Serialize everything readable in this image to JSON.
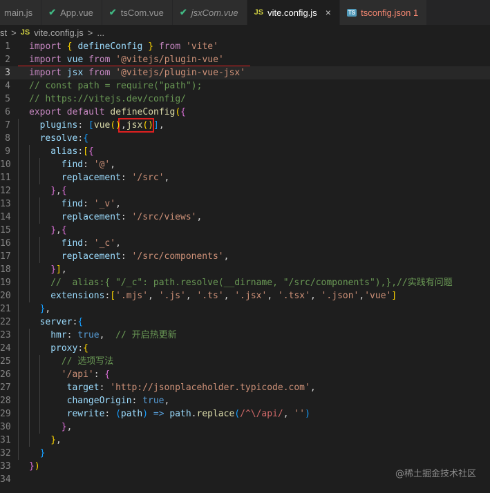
{
  "tabs": [
    {
      "label": "main.js",
      "icon": "js-icon",
      "active": false,
      "italic": false
    },
    {
      "label": "App.vue",
      "icon": "vue-icon",
      "active": false,
      "italic": false
    },
    {
      "label": "tsCom.vue",
      "icon": "vue-icon",
      "active": false,
      "italic": false
    },
    {
      "label": "jsxCom.vue",
      "icon": "vue-icon",
      "active": false,
      "italic": true
    },
    {
      "label": "vite.config.js",
      "icon": "js-icon",
      "active": true,
      "italic": false
    },
    {
      "label": "tsconfig.json 1",
      "icon": "ts-icon",
      "active": false,
      "italic": false
    }
  ],
  "breadcrumb": {
    "prefix": "st",
    "file": "vite.config.js",
    "tail": "..."
  },
  "icons": {
    "js": "JS",
    "ts": "TS",
    "vue": "V",
    "close": "×"
  },
  "colors": {
    "keyword": "#c586c0",
    "string": "#ce9178",
    "comment": "#6a9955",
    "highlight_box": "#e02020"
  },
  "current_line": 3,
  "lines": [
    {
      "n": "1",
      "indent": 0,
      "tokens": [
        [
          "kw",
          "import"
        ],
        [
          "p",
          " "
        ],
        [
          "b1",
          "{"
        ],
        [
          "p",
          " "
        ],
        [
          "var",
          "defineConfig"
        ],
        [
          "p",
          " "
        ],
        [
          "b1",
          "}"
        ],
        [
          "p",
          " "
        ],
        [
          "kw",
          "from"
        ],
        [
          "p",
          " "
        ],
        [
          "str",
          "'vite'"
        ]
      ]
    },
    {
      "n": "2",
      "indent": 0,
      "tokens": [
        [
          "kw",
          "import"
        ],
        [
          "p",
          " "
        ],
        [
          "var",
          "vue"
        ],
        [
          "p",
          " "
        ],
        [
          "kw",
          "from"
        ],
        [
          "p",
          " "
        ],
        [
          "str",
          "'@vitejs/plugin-vue'"
        ]
      ]
    },
    {
      "n": "3",
      "indent": 0,
      "tokens": [
        [
          "kw",
          "import"
        ],
        [
          "p",
          " "
        ],
        [
          "var",
          "jsx"
        ],
        [
          "p",
          " "
        ],
        [
          "kw",
          "from"
        ],
        [
          "p",
          " "
        ],
        [
          "str",
          "'@vitejs/plugin-vue-jsx'"
        ]
      ]
    },
    {
      "n": "4",
      "indent": 0,
      "tokens": [
        [
          "cmt",
          "// const path = require(\"path\");"
        ]
      ]
    },
    {
      "n": "5",
      "indent": 0,
      "tokens": [
        [
          "cmt",
          "// https://vitejs.dev/config/"
        ]
      ]
    },
    {
      "n": "6",
      "indent": 0,
      "tokens": [
        [
          "kw",
          "export"
        ],
        [
          "p",
          " "
        ],
        [
          "kw",
          "default"
        ],
        [
          "p",
          " "
        ],
        [
          "fn",
          "defineConfig"
        ],
        [
          "b1",
          "("
        ],
        [
          "b2",
          "{"
        ]
      ]
    },
    {
      "n": "7",
      "indent": 1,
      "tokens": [
        [
          "var",
          "plugins"
        ],
        [
          "p",
          ": "
        ],
        [
          "b3",
          "["
        ],
        [
          "fn",
          "vue"
        ],
        [
          "b1",
          "()"
        ],
        [
          "p",
          ","
        ],
        [
          "fn",
          "jsx"
        ],
        [
          "b1",
          "()"
        ],
        [
          "b3",
          "]"
        ],
        [
          "p",
          ","
        ]
      ]
    },
    {
      "n": "8",
      "indent": 1,
      "tokens": [
        [
          "var",
          "resolve"
        ],
        [
          "p",
          ":"
        ],
        [
          "b3",
          "{"
        ]
      ]
    },
    {
      "n": "9",
      "indent": 2,
      "tokens": [
        [
          "var",
          "alias"
        ],
        [
          "p",
          ":"
        ],
        [
          "b1",
          "["
        ],
        [
          "b2",
          "{"
        ]
      ]
    },
    {
      "n": "10",
      "indent": 3,
      "tokens": [
        [
          "var",
          "find"
        ],
        [
          "p",
          ": "
        ],
        [
          "str",
          "'@'"
        ],
        [
          "p",
          ","
        ]
      ]
    },
    {
      "n": "11",
      "indent": 3,
      "tokens": [
        [
          "var",
          "replacement"
        ],
        [
          "p",
          ": "
        ],
        [
          "str",
          "'/src'"
        ],
        [
          "p",
          ","
        ]
      ]
    },
    {
      "n": "12",
      "indent": 2,
      "tokens": [
        [
          "b2",
          "}"
        ],
        [
          "p",
          ","
        ],
        [
          "b2",
          "{"
        ]
      ]
    },
    {
      "n": "13",
      "indent": 3,
      "tokens": [
        [
          "var",
          "find"
        ],
        [
          "p",
          ": "
        ],
        [
          "str",
          "'_v'"
        ],
        [
          "p",
          ","
        ]
      ]
    },
    {
      "n": "14",
      "indent": 3,
      "tokens": [
        [
          "var",
          "replacement"
        ],
        [
          "p",
          ": "
        ],
        [
          "str",
          "'/src/views'"
        ],
        [
          "p",
          ","
        ]
      ]
    },
    {
      "n": "15",
      "indent": 2,
      "tokens": [
        [
          "b2",
          "}"
        ],
        [
          "p",
          ","
        ],
        [
          "b2",
          "{"
        ]
      ]
    },
    {
      "n": "16",
      "indent": 3,
      "tokens": [
        [
          "var",
          "find"
        ],
        [
          "p",
          ": "
        ],
        [
          "str",
          "'_c'"
        ],
        [
          "p",
          ","
        ]
      ]
    },
    {
      "n": "17",
      "indent": 3,
      "tokens": [
        [
          "var",
          "replacement"
        ],
        [
          "p",
          ": "
        ],
        [
          "str",
          "'/src/components'"
        ],
        [
          "p",
          ","
        ]
      ]
    },
    {
      "n": "18",
      "indent": 2,
      "tokens": [
        [
          "b2",
          "}"
        ],
        [
          "b1",
          "]"
        ],
        [
          "p",
          ","
        ]
      ]
    },
    {
      "n": "19",
      "indent": 2,
      "tokens": [
        [
          "cmt",
          "//  alias:{ \"/_c\": path.resolve(__dirname, \"/src/components\"),},//实践有问题"
        ]
      ]
    },
    {
      "n": "20",
      "indent": 2,
      "tokens": [
        [
          "var",
          "extensions"
        ],
        [
          "p",
          ":"
        ],
        [
          "b1",
          "["
        ],
        [
          "str",
          "'.mjs'"
        ],
        [
          "p",
          ", "
        ],
        [
          "str",
          "'.js'"
        ],
        [
          "p",
          ", "
        ],
        [
          "str",
          "'.ts'"
        ],
        [
          "p",
          ", "
        ],
        [
          "str",
          "'.jsx'"
        ],
        [
          "p",
          ", "
        ],
        [
          "str",
          "'.tsx'"
        ],
        [
          "p",
          ", "
        ],
        [
          "str",
          "'.json'"
        ],
        [
          "p",
          ","
        ],
        [
          "str",
          "'vue'"
        ],
        [
          "b1",
          "]"
        ]
      ]
    },
    {
      "n": "21",
      "indent": 1,
      "tokens": [
        [
          "b3",
          "}"
        ],
        [
          "p",
          ","
        ]
      ]
    },
    {
      "n": "22",
      "indent": 1,
      "tokens": [
        [
          "var",
          "server"
        ],
        [
          "p",
          ":"
        ],
        [
          "b3",
          "{"
        ]
      ]
    },
    {
      "n": "23",
      "indent": 2,
      "tokens": [
        [
          "var",
          "hmr"
        ],
        [
          "p",
          ": "
        ],
        [
          "kw2",
          "true"
        ],
        [
          "p",
          ",  "
        ],
        [
          "cmt",
          "// 开启热更新"
        ]
      ]
    },
    {
      "n": "24",
      "indent": 2,
      "tokens": [
        [
          "var",
          "proxy"
        ],
        [
          "p",
          ":"
        ],
        [
          "b1",
          "{"
        ]
      ]
    },
    {
      "n": "25",
      "indent": 3,
      "tokens": [
        [
          "cmt",
          "// 选项写法"
        ]
      ]
    },
    {
      "n": "26",
      "indent": 3,
      "tokens": [
        [
          "str",
          "'/api'"
        ],
        [
          "p",
          ": "
        ],
        [
          "b2",
          "{"
        ]
      ]
    },
    {
      "n": "27",
      "indent": 3,
      "tokens": [
        [
          "p",
          " "
        ],
        [
          "var",
          "target"
        ],
        [
          "p",
          ": "
        ],
        [
          "str",
          "'http://jsonplaceholder.typicode.com'"
        ],
        [
          "p",
          ","
        ]
      ]
    },
    {
      "n": "28",
      "indent": 3,
      "tokens": [
        [
          "p",
          " "
        ],
        [
          "var",
          "changeOrigin"
        ],
        [
          "p",
          ": "
        ],
        [
          "kw2",
          "true"
        ],
        [
          "p",
          ","
        ]
      ]
    },
    {
      "n": "29",
      "indent": 3,
      "tokens": [
        [
          "p",
          " "
        ],
        [
          "var",
          "rewrite"
        ],
        [
          "p",
          ": "
        ],
        [
          "b3",
          "("
        ],
        [
          "var",
          "path"
        ],
        [
          "b3",
          ")"
        ],
        [
          "p",
          " "
        ],
        [
          "kw2",
          "=>"
        ],
        [
          "p",
          " "
        ],
        [
          "var",
          "path"
        ],
        [
          "p",
          "."
        ],
        [
          "fn",
          "replace"
        ],
        [
          "b3",
          "("
        ],
        [
          "re",
          "/^\\/api/"
        ],
        [
          "p",
          ", "
        ],
        [
          "str",
          "''"
        ],
        [
          "b3",
          ")"
        ]
      ]
    },
    {
      "n": "30",
      "indent": 3,
      "tokens": [
        [
          "b2",
          "}"
        ],
        [
          "p",
          ","
        ]
      ]
    },
    {
      "n": "31",
      "indent": 2,
      "tokens": [
        [
          "b1",
          "}"
        ],
        [
          "p",
          ","
        ]
      ]
    },
    {
      "n": "32",
      "indent": 1,
      "tokens": [
        [
          "b3",
          "}"
        ]
      ]
    },
    {
      "n": "33",
      "indent": 0,
      "tokens": [
        [
          "b2",
          "}"
        ],
        [
          "b1",
          ")"
        ]
      ]
    },
    {
      "n": "34",
      "indent": 0,
      "tokens": []
    }
  ],
  "watermark": "@稀土掘金技术社区"
}
